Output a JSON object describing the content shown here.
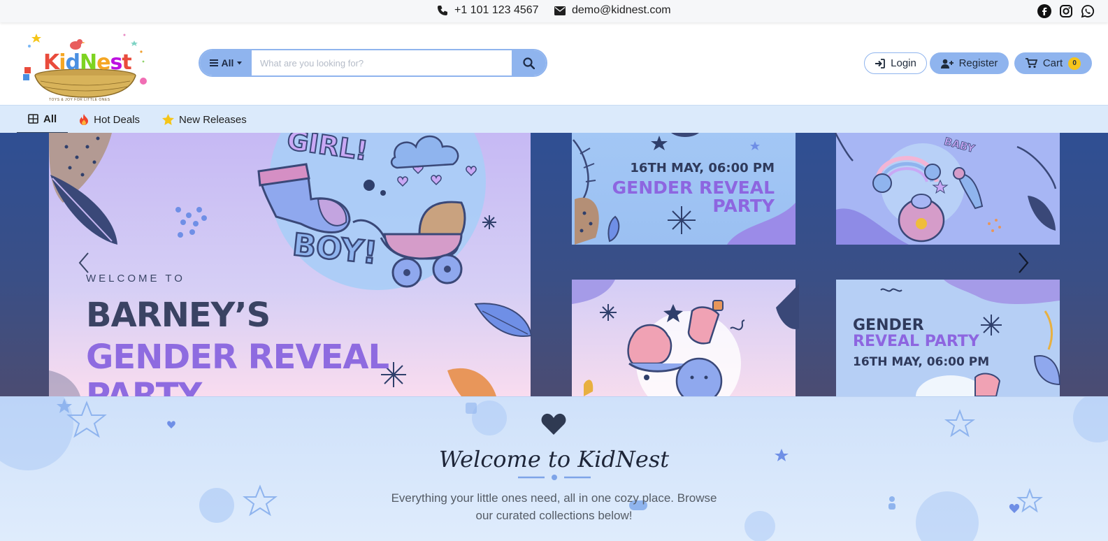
{
  "topbar": {
    "phone": "+1 101 123 4567",
    "email": "demo@kidnest.com",
    "socials": [
      "facebook-icon",
      "instagram-icon",
      "whatsapp-icon"
    ]
  },
  "brand": {
    "name_letters": [
      "K",
      "i",
      "d",
      "N",
      "e",
      "s",
      "t"
    ],
    "tagline": "TOYS & JOY FOR LITTLE ONES",
    "colors": [
      "#e94b3c",
      "#f5a623",
      "#4a90e2",
      "#7ed321",
      "#f5a623",
      "#bd10e0",
      "#e94b3c"
    ]
  },
  "search": {
    "category_label": "All",
    "placeholder": "What are you looking for?",
    "value": ""
  },
  "account": {
    "login_label": "Login",
    "register_label": "Register",
    "cart_label": "Cart",
    "cart_count": "0"
  },
  "nav": {
    "items": [
      {
        "label": "All",
        "icon": "grid-icon",
        "active": true
      },
      {
        "label": "Hot Deals",
        "icon": "fire-icon"
      },
      {
        "label": "New Releases",
        "icon": "star-icon"
      }
    ]
  },
  "hero": {
    "welcome_to": "WELCOME TO",
    "line1": "BARNEY’S",
    "line2": "GENDER REVEAL",
    "line3": "PARTY",
    "card1_date": "16TH MAY, 06:00 PM",
    "card1_title_1": "GENDER REVEAL",
    "card1_title_2": "PARTY",
    "card2_word": "BABY",
    "card4_title_1": "GENDER",
    "card4_title_2": "REVEAL PARTY",
    "card4_date": "16TH MAY, 06:00 PM",
    "girl_text": "GIRL!",
    "boy_text": "BOY!"
  },
  "welcome": {
    "title": "Welcome to KidNest",
    "description": "Everything your little ones need, all in one cozy place. Browse our curated collections below!"
  },
  "colors": {
    "accent": "#8fb4ee",
    "nav_bg": "#dbeafb",
    "badge": "#f5c51b",
    "purple": "#8d66e0",
    "navy": "#3a4363"
  }
}
